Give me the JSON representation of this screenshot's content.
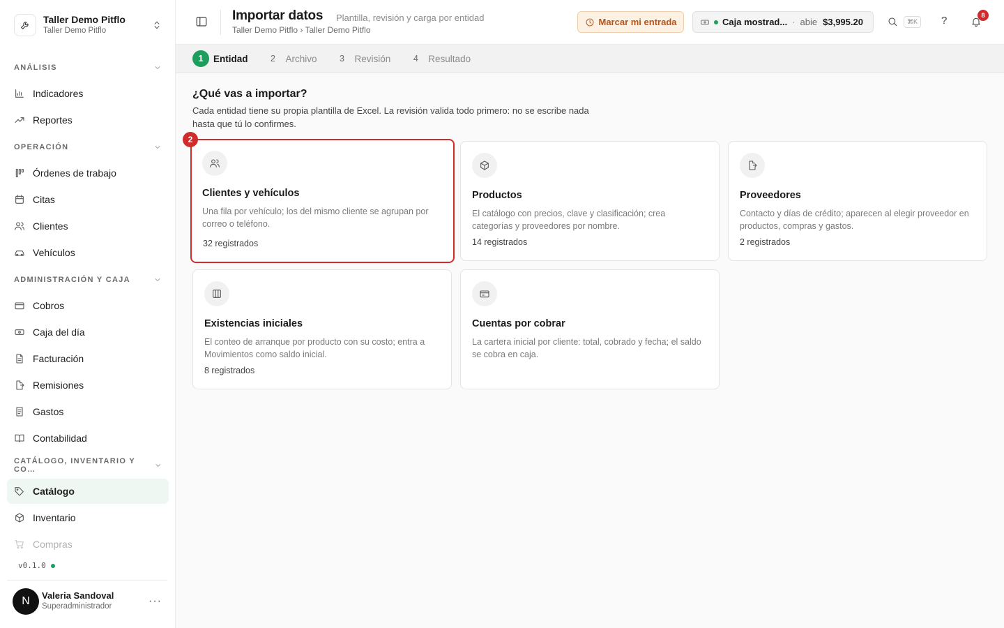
{
  "org": {
    "name": "Taller Demo Pitflo",
    "subtitle": "Taller Demo Pitflo"
  },
  "sidebar": {
    "sections": [
      {
        "title": "ANÁLISIS",
        "items": [
          {
            "label": "Indicadores",
            "icon": "bar-chart-icon"
          },
          {
            "label": "Reportes",
            "icon": "trend-up-icon"
          }
        ]
      },
      {
        "title": "OPERACIÓN",
        "items": [
          {
            "label": "Órdenes de trabajo",
            "icon": "kanban-icon"
          },
          {
            "label": "Citas",
            "icon": "calendar-icon"
          },
          {
            "label": "Clientes",
            "icon": "users-icon"
          },
          {
            "label": "Vehículos",
            "icon": "car-icon"
          }
        ]
      },
      {
        "title": "ADMINISTRACIÓN Y CAJA",
        "items": [
          {
            "label": "Cobros",
            "icon": "credit-card-icon"
          },
          {
            "label": "Caja del día",
            "icon": "banknote-icon"
          },
          {
            "label": "Facturación",
            "icon": "file-text-icon"
          },
          {
            "label": "Remisiones",
            "icon": "file-export-icon"
          },
          {
            "label": "Gastos",
            "icon": "receipt-icon"
          },
          {
            "label": "Contabilidad",
            "icon": "book-open-icon"
          }
        ]
      },
      {
        "title": "CATÁLOGO, INVENTARIO Y CO…",
        "items": [
          {
            "label": "Catálogo",
            "icon": "tags-icon",
            "active": true
          },
          {
            "label": "Inventario",
            "icon": "box-icon"
          },
          {
            "label": "Compras",
            "icon": "cart-icon"
          }
        ]
      }
    ]
  },
  "version": "v0.1.0",
  "user": {
    "initial": "N",
    "name": "Valeria Sandoval",
    "role": "Superadministrador"
  },
  "topbar": {
    "title": "Importar datos",
    "subtitle": "Plantilla, revisión y carga por entidad",
    "breadcrumb": "Taller Demo Pitflo › Taller Demo Pitflo",
    "mark_entry": "Marcar mi entrada",
    "caja": {
      "name": "Caja mostrad...",
      "separator": "·",
      "status": "abie",
      "amount": "$3,995.20"
    },
    "shortcut": "⌘K",
    "help": "?",
    "notifications": "8"
  },
  "steps": [
    {
      "num": "1",
      "label": "Entidad",
      "active": true
    },
    {
      "num": "2",
      "label": "Archivo"
    },
    {
      "num": "3",
      "label": "Revisión"
    },
    {
      "num": "4",
      "label": "Resultado"
    }
  ],
  "main": {
    "heading": "¿Qué vas a importar?",
    "description": "Cada entidad tiene su propia plantilla de Excel. La revisión valida todo primero: no se escribe nada hasta que tú lo confirmes.",
    "selected_badge": "2",
    "cards": [
      {
        "title": "Clientes y vehículos",
        "description": "Una fila por vehículo; los del mismo cliente se agrupan por correo o teléfono.",
        "count": "32 registrados",
        "icon": "users-icon",
        "selected": true
      },
      {
        "title": "Productos",
        "description": "El catálogo con precios, clave y clasificación; crea categorías y proveedores por nombre.",
        "count": "14 registrados",
        "icon": "box-icon"
      },
      {
        "title": "Proveedores",
        "description": "Contacto y días de crédito; aparecen al elegir proveedor en productos, compras y gastos.",
        "count": "2 registrados",
        "icon": "file-export-icon"
      },
      {
        "title": "Existencias iniciales",
        "description": "El conteo de arranque por producto con su costo; entra a Movimientos como saldo inicial.",
        "count": "8 registrados",
        "icon": "columns-icon"
      },
      {
        "title": "Cuentas por cobrar",
        "description": "La cartera inicial por cliente: total, cobrado y fecha; el saldo se cobra en caja.",
        "count": "",
        "icon": "credit-card-icon"
      }
    ]
  }
}
